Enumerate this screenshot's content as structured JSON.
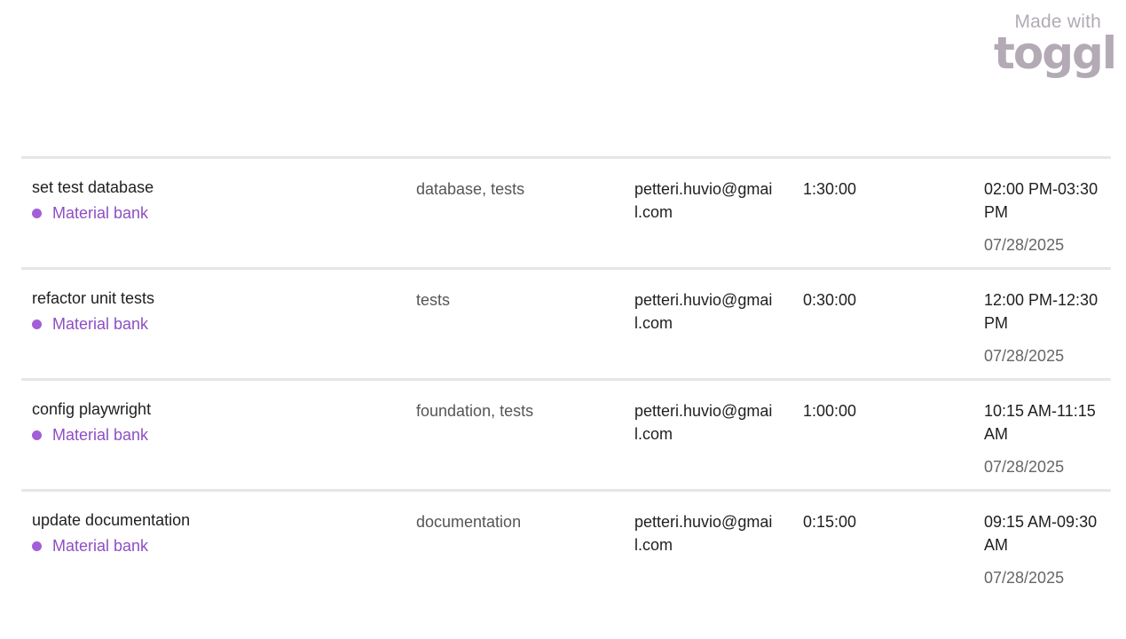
{
  "branding": {
    "made_with": "Made with",
    "logo_text": "toggl"
  },
  "colors": {
    "project_dot": "#a35fd8",
    "project_text": "#8e4fc4",
    "divider": "#e6e6e6",
    "brand_gray": "#b3aab6"
  },
  "entries": [
    {
      "description": "set test database",
      "project": "Material bank",
      "tags": "database, tests",
      "user": "petteri.huvio@gmail.com",
      "duration": "1:30:00",
      "time_range": "02:00 PM-03:30 PM",
      "date": "07/28/2025"
    },
    {
      "description": "refactor unit tests",
      "project": "Material bank",
      "tags": "tests",
      "user": "petteri.huvio@gmail.com",
      "duration": "0:30:00",
      "time_range": "12:00 PM-12:30 PM",
      "date": "07/28/2025"
    },
    {
      "description": "config playwright",
      "project": "Material bank",
      "tags": "foundation, tests",
      "user": "petteri.huvio@gmail.com",
      "duration": "1:00:00",
      "time_range": "10:15 AM-11:15 AM",
      "date": "07/28/2025"
    },
    {
      "description": "update documentation",
      "project": "Material bank",
      "tags": "documentation",
      "user": "petteri.huvio@gmail.com",
      "duration": "0:15:00",
      "time_range": "09:15 AM-09:30 AM",
      "date": "07/28/2025"
    }
  ]
}
